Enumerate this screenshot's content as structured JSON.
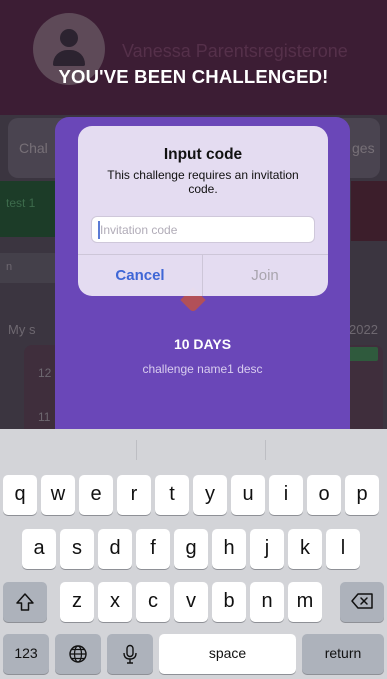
{
  "background": {
    "user_name": "Vanessa Parentsregisterone",
    "tab_left": "Chal",
    "tab_right": "ges",
    "card_label": "test 1",
    "input_stub": "n",
    "section_label": "My s",
    "year_stub": "2022",
    "card_day_top": "12",
    "card_day_bottom": "11"
  },
  "modal": {
    "title": "YOU'VE BEEN CHALLENGED!",
    "days_label": "10 DAYS",
    "description": "challenge name1 desc"
  },
  "alert": {
    "title": "Input code",
    "message": "This challenge requires an invitation code.",
    "input_placeholder": "Invitation code",
    "cancel_label": "Cancel",
    "join_label": "Join"
  },
  "keyboard": {
    "row1": [
      "q",
      "w",
      "e",
      "r",
      "t",
      "y",
      "u",
      "i",
      "o",
      "p"
    ],
    "row2": [
      "a",
      "s",
      "d",
      "f",
      "g",
      "h",
      "j",
      "k",
      "l"
    ],
    "row3": [
      "z",
      "x",
      "c",
      "v",
      "b",
      "n",
      "m"
    ],
    "numbers_label": "123",
    "space_label": "space",
    "return_label": "return"
  },
  "colors": {
    "accent_blue": "#3f67d6",
    "challenge_purple": "#6a47b8",
    "dim_header": "#3c1d34"
  }
}
